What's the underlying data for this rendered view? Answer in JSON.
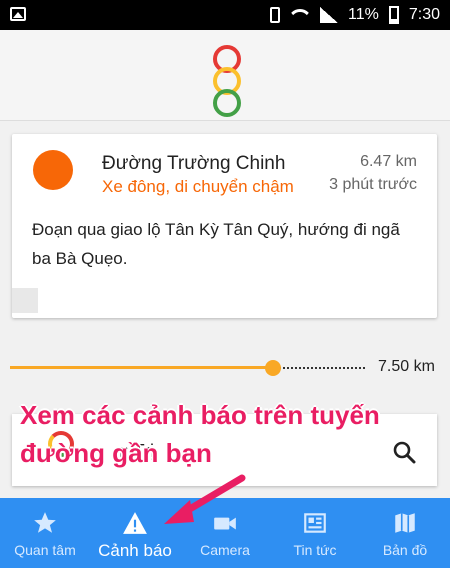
{
  "status_bar": {
    "battery_percent": "11%",
    "time": "7:30"
  },
  "alert": {
    "road": "Đường Trường Chinh",
    "status": "Xe đông, di chuyển chậm",
    "distance": "6.47 km",
    "time_ago": "3 phút trước",
    "description": "Đoạn qua giao lộ Tân Kỳ Tân Quý, hướng đi ngã ba Bà Quẹo.",
    "status_color": "#f76707"
  },
  "radius": {
    "value_label": "7.50 km",
    "fraction": 0.74
  },
  "search": {
    "visible_text": "n Trị"
  },
  "overlay_caption": "Xem các cảnh báo trên tuyến đường gần bạn",
  "bottom_nav": {
    "items": [
      {
        "label": "Quan tâm",
        "icon": "star-icon"
      },
      {
        "label": "Cảnh báo",
        "icon": "warning-icon"
      },
      {
        "label": "Camera",
        "icon": "camera-icon"
      },
      {
        "label": "Tin tức",
        "icon": "news-icon"
      },
      {
        "label": "Bản đồ",
        "icon": "map-icon"
      }
    ],
    "active_index": 1
  },
  "colors": {
    "accent": "#2f8ff2",
    "annotation": "#e91e63"
  }
}
